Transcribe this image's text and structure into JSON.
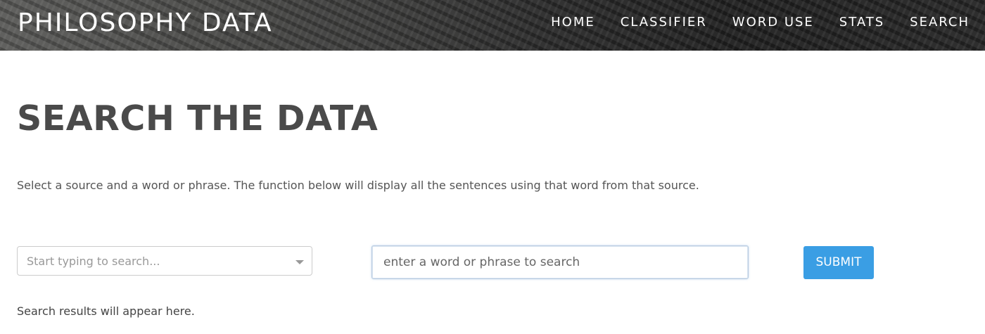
{
  "navbar": {
    "brand": "PHILOSOPHY DATA",
    "links": [
      {
        "label": "HOME",
        "name": "nav-link-home"
      },
      {
        "label": "CLASSIFIER",
        "name": "nav-link-classifier"
      },
      {
        "label": "WORD USE",
        "name": "nav-link-word-use"
      },
      {
        "label": "STATS",
        "name": "nav-link-stats"
      },
      {
        "label": "SEARCH",
        "name": "nav-link-search"
      }
    ]
  },
  "main": {
    "title": "SEARCH THE DATA",
    "intro": "Select a source and a word or phrase. The function below will display all the sentences using that word from that source.",
    "source_select": {
      "placeholder": "Start typing to search...",
      "value": ""
    },
    "word_input": {
      "placeholder": "enter a word or phrase to search",
      "value": ""
    },
    "submit_label": "SUBMIT",
    "results_text": "Search results will appear here."
  },
  "colors": {
    "accent": "#3a9ee4",
    "heading": "#4a4a4a",
    "navbar_text": "#ffffff"
  },
  "icons": {
    "select_caret": "caret-down-icon"
  }
}
